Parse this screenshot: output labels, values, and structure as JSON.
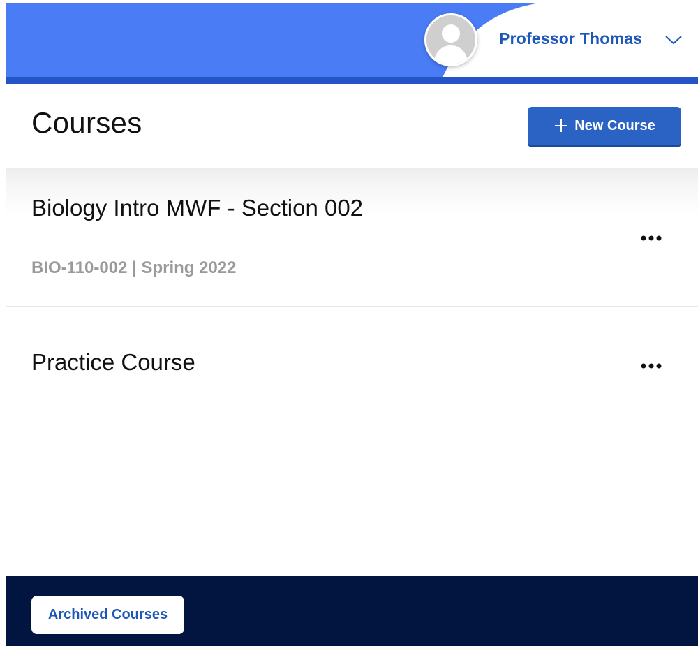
{
  "header": {
    "user_name": "Professor Thomas",
    "avatar_icon": "user-avatar-icon",
    "menu_icon": "chevron-down-icon",
    "colors": {
      "header_blue": "#4a7cf6",
      "header_bar": "#2554c7",
      "name_text": "#1d57b8"
    }
  },
  "page": {
    "title": "Courses",
    "new_course_label": "New Course",
    "new_course_icon": "plus-icon",
    "button_color": "#2a63c4"
  },
  "courses": [
    {
      "title": "Biology Intro MWF - Section 002",
      "meta": "BIO-110-002 | Spring 2022",
      "menu_icon": "more-horizontal-icon"
    },
    {
      "title": "Practice Course",
      "menu_icon": "more-horizontal-icon"
    }
  ],
  "footer": {
    "archived_label": "Archived Courses",
    "background": "#021440"
  }
}
